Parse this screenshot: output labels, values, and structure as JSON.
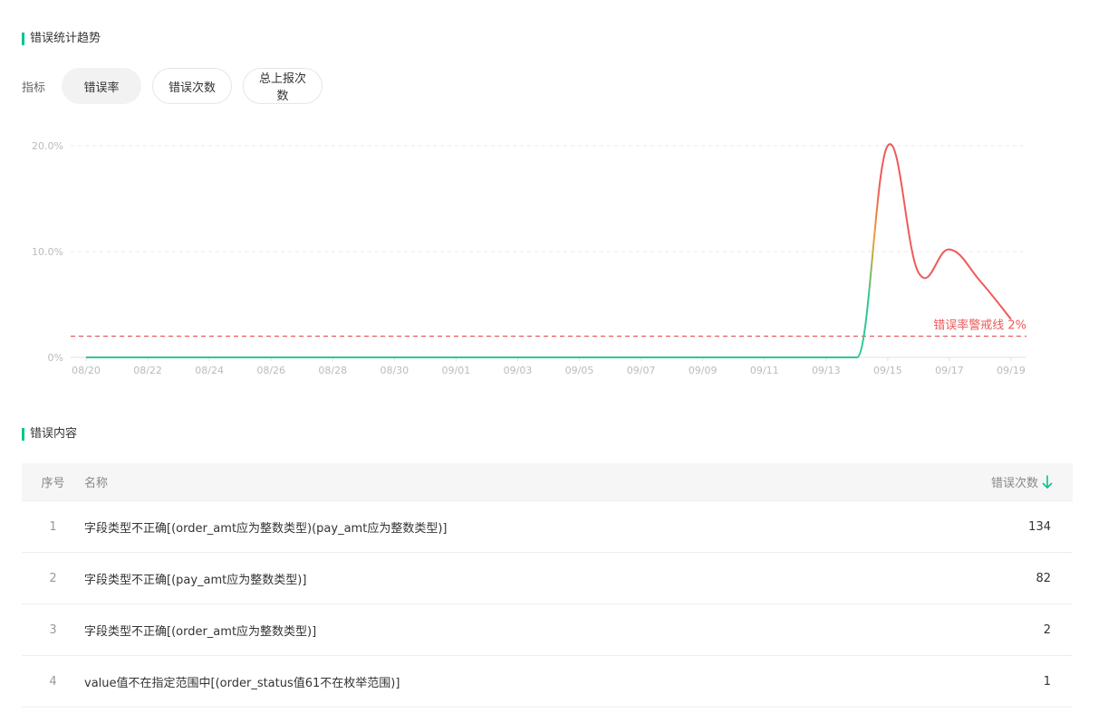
{
  "trend_section": {
    "title": "错误统计趋势"
  },
  "metric": {
    "label": "指标",
    "options": [
      {
        "label": "错误率",
        "active": true
      },
      {
        "label": "错误次数",
        "active": false
      },
      {
        "label": "总上报次数",
        "active": false
      }
    ]
  },
  "chart_data": {
    "type": "line",
    "x": [
      "08/20",
      "08/21",
      "08/22",
      "08/23",
      "08/24",
      "08/25",
      "08/26",
      "08/27",
      "08/28",
      "08/29",
      "08/30",
      "08/31",
      "09/01",
      "09/02",
      "09/03",
      "09/04",
      "09/05",
      "09/06",
      "09/07",
      "09/08",
      "09/09",
      "09/10",
      "09/11",
      "09/12",
      "09/13",
      "09/14",
      "09/15",
      "09/16",
      "09/17",
      "09/18",
      "09/19"
    ],
    "x_tick_labels": [
      "08/20",
      "08/22",
      "08/24",
      "08/26",
      "08/28",
      "08/30",
      "09/01",
      "09/03",
      "09/05",
      "09/07",
      "09/09",
      "09/11",
      "09/13",
      "09/15",
      "09/17",
      "09/19"
    ],
    "series": [
      {
        "values": [
          0,
          0,
          0,
          0,
          0,
          0,
          0,
          0,
          0,
          0,
          0,
          0,
          0,
          0,
          0,
          0,
          0,
          0,
          0,
          0,
          0,
          0,
          0,
          0,
          0,
          0,
          20.0,
          8.0,
          10.2,
          7.2,
          3.6
        ]
      }
    ],
    "y_ticks": [
      "0%",
      "10.0%",
      "20.0%"
    ],
    "ylim": [
      0,
      20
    ],
    "threshold": {
      "value": 2,
      "label": "错误率警戒线 2%"
    },
    "grid": true,
    "colors": {
      "ok": "#2fc894",
      "alert": "#ee5a5a",
      "grid": "#e8e8e8",
      "axis_text": "#bbbbbb"
    }
  },
  "content_section": {
    "title": "错误内容"
  },
  "table": {
    "headers": {
      "index": "序号",
      "name": "名称",
      "count": "错误次数"
    },
    "rows": [
      {
        "index": "1",
        "name": "字段类型不正确[(order_amt应为整数类型)(pay_amt应为整数类型)]",
        "count": "134"
      },
      {
        "index": "2",
        "name": "字段类型不正确[(pay_amt应为整数类型)]",
        "count": "82"
      },
      {
        "index": "3",
        "name": "字段类型不正确[(order_amt应为整数类型)]",
        "count": "2"
      },
      {
        "index": "4",
        "name": "value值不在指定范围中[(order_status值61不在枚举范围)]",
        "count": "1"
      }
    ]
  },
  "accent_color": "#00c58e"
}
